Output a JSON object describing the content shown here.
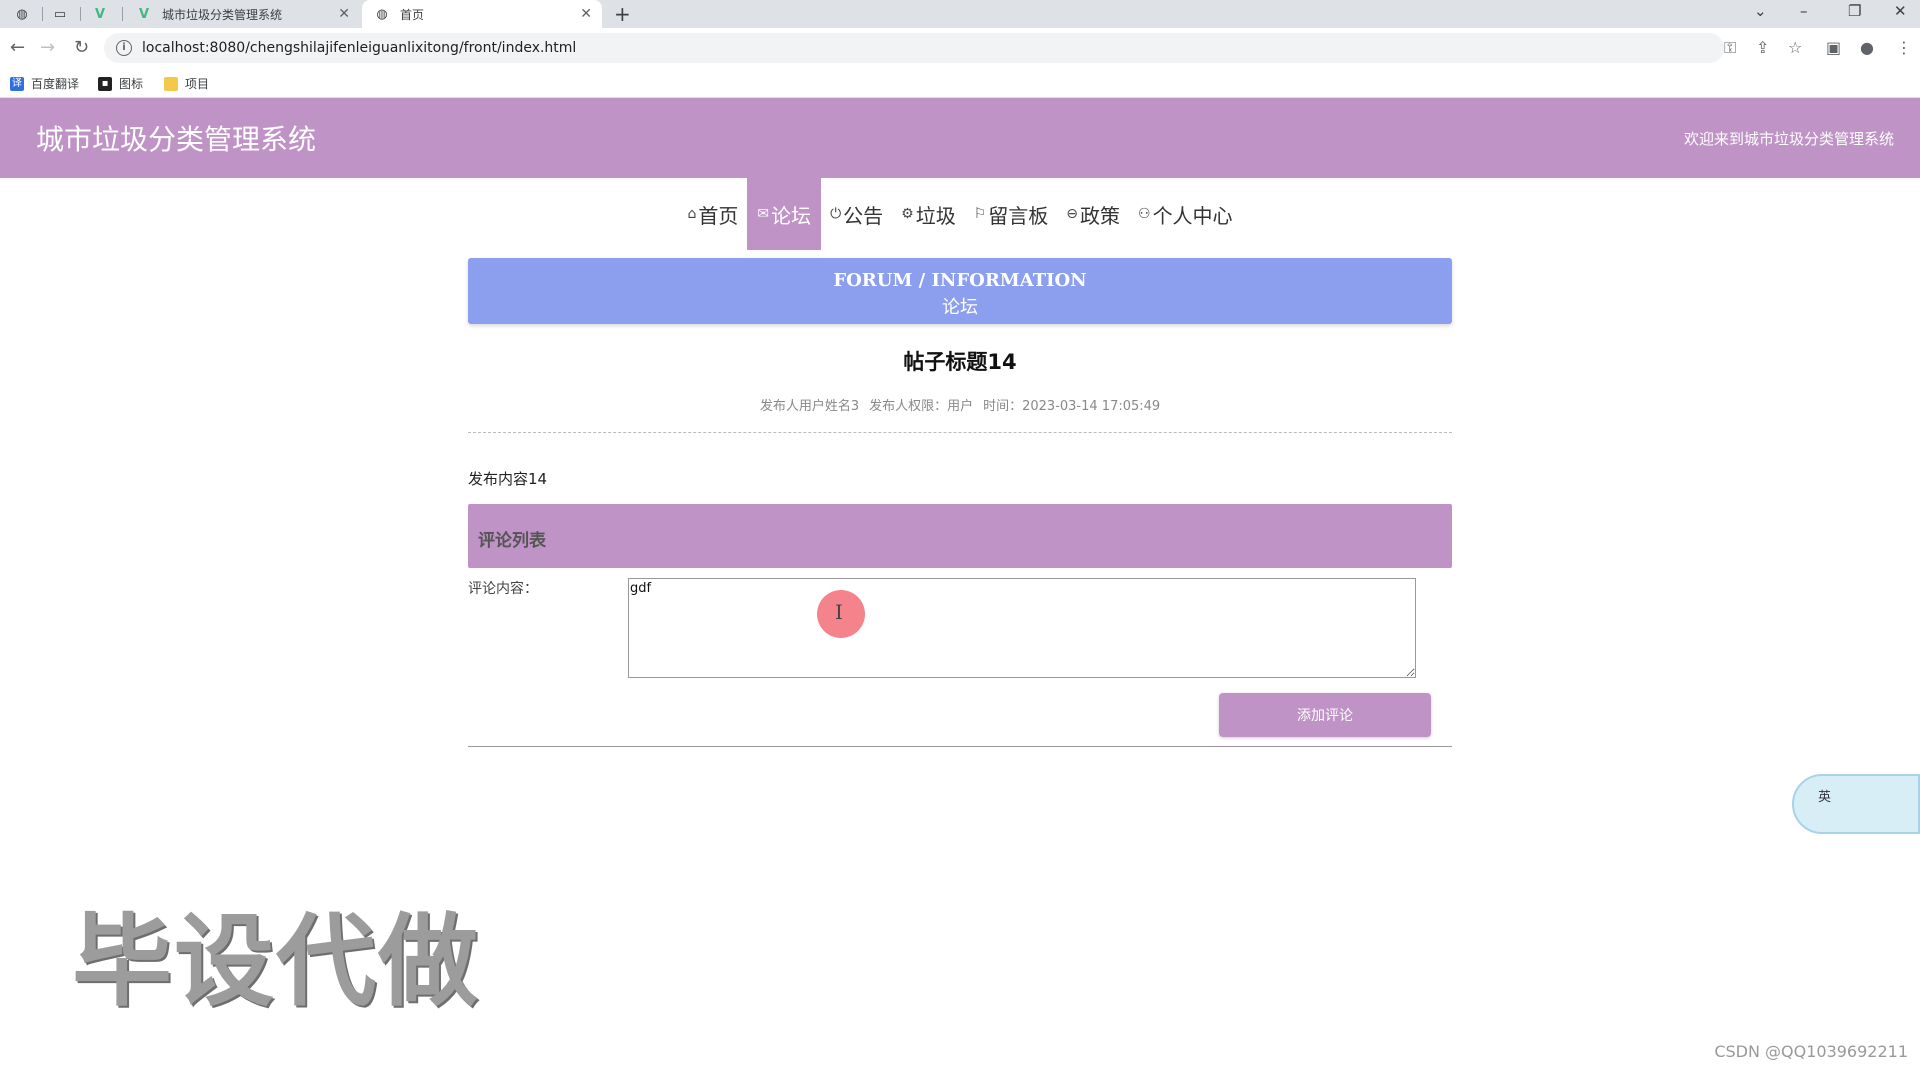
{
  "browser": {
    "tabs": [
      {
        "title": "",
        "icon": "globe-icon"
      },
      {
        "title": "",
        "icon": "blank-page-icon"
      },
      {
        "title": "",
        "icon": "vue-icon"
      },
      {
        "title": "城市垃圾分类管理系统",
        "icon": "vue-icon"
      },
      {
        "title": "首页",
        "icon": "globe-icon",
        "active": true
      }
    ],
    "url": "localhost:8080/chengshilajifenleiguanlixitong/front/index.html",
    "bookmarks": [
      {
        "label": "百度翻译",
        "color": "#2f6fe0"
      },
      {
        "label": "图标",
        "color": "#222222"
      },
      {
        "label": "项目",
        "color": "#f2c94c"
      }
    ]
  },
  "site": {
    "title": "城市垃圾分类管理系统",
    "welcome": "欢迎来到城市垃圾分类管理系统",
    "accent": "#bf93c6",
    "banner_color": "#8c9fee"
  },
  "nav": {
    "items": [
      {
        "label": "首页",
        "icon": "home-icon"
      },
      {
        "label": "论坛",
        "icon": "mail-icon",
        "active": true
      },
      {
        "label": "公告",
        "icon": "power-icon"
      },
      {
        "label": "垃圾",
        "icon": "gear-icon"
      },
      {
        "label": "留言板",
        "icon": "flag-icon"
      },
      {
        "label": "政策",
        "icon": "policy-icon"
      },
      {
        "label": "个人中心",
        "icon": "user-icon"
      }
    ]
  },
  "banner": {
    "en": "FORUM / INFORMATION",
    "cn": "论坛"
  },
  "post": {
    "title": "帖子标题14",
    "author": "发布人用户姓名3",
    "role": "发布人权限：用户",
    "time": "时间：2023-03-14 17:05:49",
    "content": "发布内容14"
  },
  "comments": {
    "header": "评论列表",
    "label": "评论内容：",
    "input_value": "gdf",
    "submit_label": "添加评论"
  },
  "overlay": {
    "ime_label": "英",
    "watermark": "毕设代做",
    "credit": "CSDN @QQ1039692211"
  }
}
